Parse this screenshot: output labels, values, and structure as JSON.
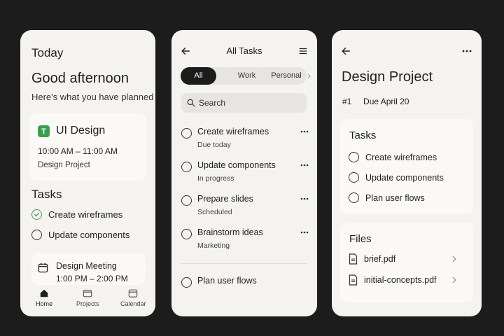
{
  "today_screen": {
    "title": "Today",
    "greeting": "Good afternoon",
    "subtitle": "Here's what you have planned",
    "event": {
      "badge": "T",
      "title": "UI Design",
      "time": "10:00 AM – 11:00 AM",
      "project": "Design Project",
      "badge_color": "#3d9e52"
    },
    "tasks_heading": "Tasks",
    "tasks": [
      {
        "label": "Create wireframes",
        "done": true
      },
      {
        "label": "Update components",
        "done": false
      }
    ],
    "meeting": {
      "title": "Design Meeting",
      "time": "1:00 PM – 2:00 PM",
      "icon": "calendar-icon"
    },
    "tabbar": [
      {
        "label": "Home",
        "icon": "home-icon",
        "active": true
      },
      {
        "label": "Projects",
        "icon": "folder-icon",
        "active": false
      },
      {
        "label": "Calendar",
        "icon": "calendar-icon",
        "active": false
      }
    ]
  },
  "all_tasks_screen": {
    "title": "All Tasks",
    "filters": [
      "All",
      "Work",
      "Personal"
    ],
    "active_filter": "All",
    "search_placeholder": "Search",
    "tasks": [
      {
        "title": "Create wireframes",
        "subtitle": "Due today"
      },
      {
        "title": "Update components",
        "subtitle": "In progress"
      },
      {
        "title": "Prepare slides",
        "subtitle": "Scheduled"
      },
      {
        "title": "Brainstorm ideas",
        "subtitle": "Marketing"
      }
    ],
    "extra_task": "Plan user flows"
  },
  "project_screen": {
    "title": "Design Project",
    "number": "#1",
    "due": "Due April 20",
    "tasks_heading": "Tasks",
    "tasks": [
      "Create wireframes",
      "Update components",
      "Plan user flows"
    ],
    "files_heading": "Files",
    "files": [
      "brief.pdf",
      "initial-concepts.pdf"
    ]
  },
  "colors": {
    "background": "#1c1c1c",
    "surface": "#f4f3ef",
    "accent": "#3d9e52"
  }
}
